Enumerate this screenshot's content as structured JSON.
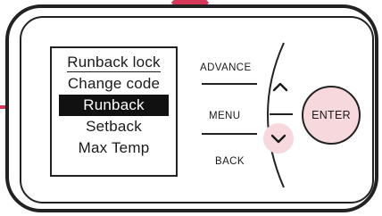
{
  "screen": {
    "menu_items": [
      {
        "label": "Runback lock",
        "style": "underlined"
      },
      {
        "label": "Change code",
        "style": "normal"
      },
      {
        "label": "Runback",
        "style": "selected"
      },
      {
        "label": "Setback",
        "style": "normal"
      },
      {
        "label": "Max Temp",
        "style": "normal"
      }
    ]
  },
  "buttons": {
    "advance_label": "ADVANCE",
    "menu_label": "MENU",
    "back_label": "BACK",
    "enter_label": "ENTER",
    "up_icon": "chevron-up-icon",
    "down_icon": "chevron-down-icon"
  },
  "colors": {
    "accent": "#d63857",
    "highlight": "#f7d8dc",
    "outline": "#222222",
    "selection": "#111111"
  }
}
